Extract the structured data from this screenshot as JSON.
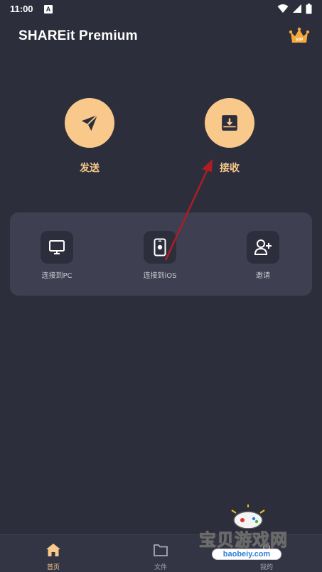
{
  "status_bar": {
    "time": "11:00",
    "notification_letter": "A"
  },
  "header": {
    "title": "SHAREit Premium",
    "vip_badge": "VIP",
    "vip_icon": "crown-icon"
  },
  "actions": {
    "send": {
      "label": "发送",
      "icon": "paper-plane-icon"
    },
    "receive": {
      "label": "接收",
      "icon": "download-box-icon"
    }
  },
  "connect": {
    "pc": {
      "label": "连接到PC",
      "icon": "monitor-icon"
    },
    "ios": {
      "label": "连接到iOS",
      "icon": "iphone-icon"
    },
    "invite": {
      "label": "邀请",
      "icon": "add-user-icon"
    }
  },
  "nav": {
    "home": {
      "label": "首页",
      "icon": "home-icon"
    },
    "files": {
      "label": "文件",
      "icon": "folder-icon"
    },
    "me": {
      "label": "我的",
      "icon": "profile-icon"
    }
  },
  "watermark": {
    "text": "宝贝游戏网",
    "url": "baobeiy.com"
  },
  "colors": {
    "background": "#2d2e3c",
    "card": "#3e3f50",
    "accent": "#f9c98b",
    "annotation_arrow": "#b01c24"
  }
}
